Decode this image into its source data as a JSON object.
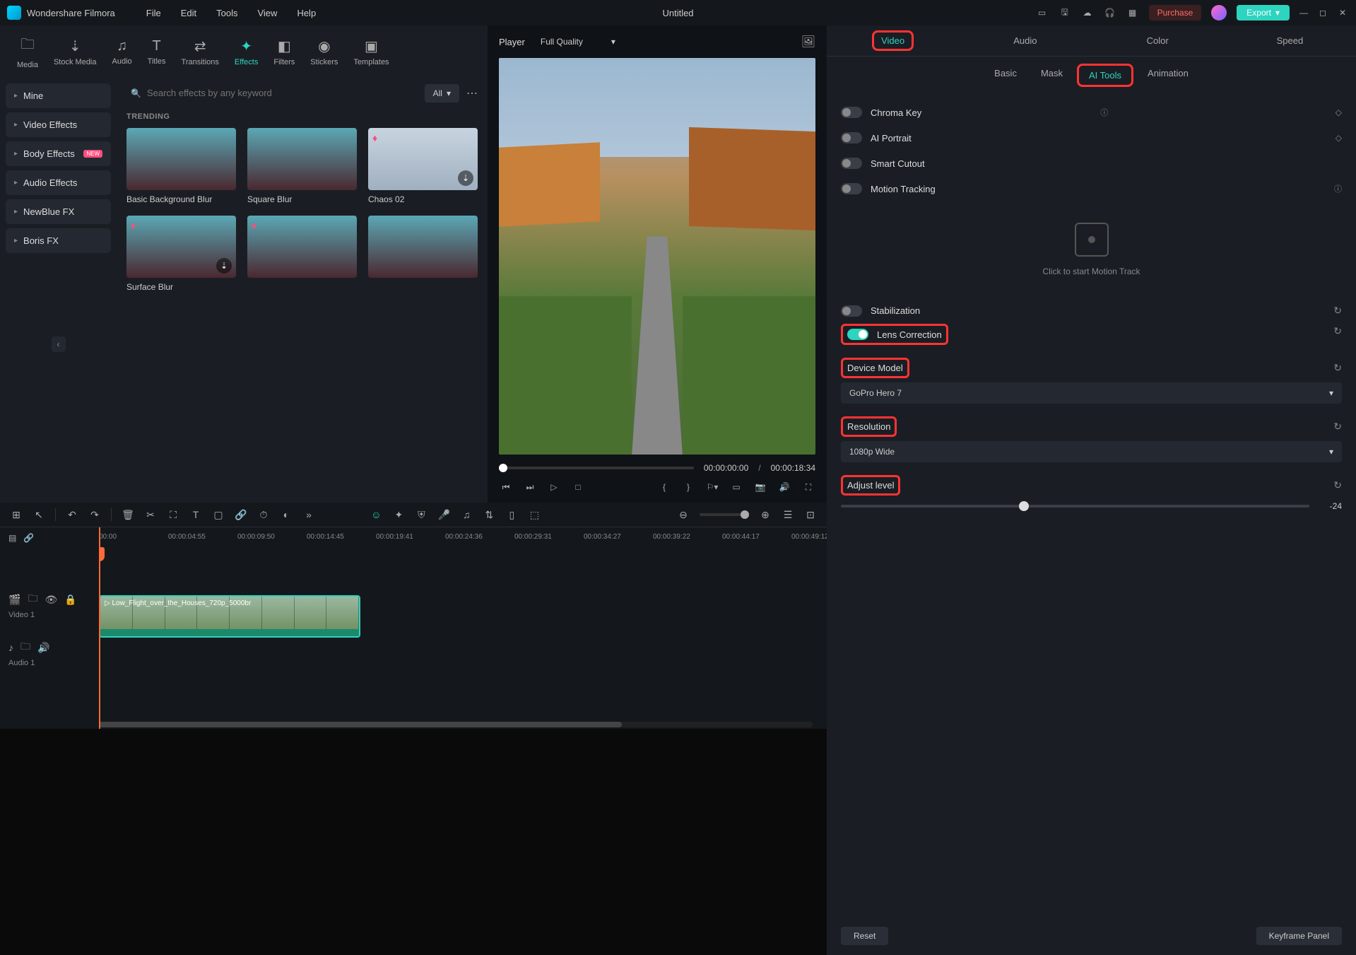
{
  "app": {
    "name": "Wondershare Filmora",
    "doc_title": "Untitled"
  },
  "menubar": [
    "File",
    "Edit",
    "Tools",
    "View",
    "Help"
  ],
  "titlebar_buttons": {
    "purchase": "Purchase",
    "export": "Export"
  },
  "media_tabs": [
    {
      "label": "Media"
    },
    {
      "label": "Stock Media"
    },
    {
      "label": "Audio"
    },
    {
      "label": "Titles"
    },
    {
      "label": "Transitions"
    },
    {
      "label": "Effects"
    },
    {
      "label": "Filters"
    },
    {
      "label": "Stickers"
    },
    {
      "label": "Templates"
    }
  ],
  "sidebar": {
    "items": [
      {
        "label": "Mine"
      },
      {
        "label": "Video Effects"
      },
      {
        "label": "Body Effects",
        "badge": "NEW"
      },
      {
        "label": "Audio Effects"
      },
      {
        "label": "NewBlue FX"
      },
      {
        "label": "Boris FX"
      }
    ]
  },
  "search": {
    "placeholder": "Search effects by any keyword",
    "filter": "All"
  },
  "effects": {
    "section": "TRENDING",
    "items": [
      {
        "label": "Basic Background Blur"
      },
      {
        "label": "Square Blur"
      },
      {
        "label": "Chaos 02"
      },
      {
        "label": "Surface Blur"
      }
    ]
  },
  "player": {
    "label": "Player",
    "quality": "Full Quality",
    "current_time": "00:00:00:00",
    "duration": "00:00:18:34"
  },
  "props": {
    "tabs": [
      "Video",
      "Audio",
      "Color",
      "Speed"
    ],
    "subtabs": [
      "Basic",
      "Mask",
      "AI Tools",
      "Animation"
    ],
    "chroma_key": "Chroma Key",
    "ai_portrait": "AI Portrait",
    "smart_cutout": "Smart Cutout",
    "motion_tracking": "Motion Tracking",
    "motion_track_hint": "Click to start Motion Track",
    "stabilization": "Stabilization",
    "lens_correction": "Lens Correction",
    "device_model": {
      "label": "Device Model",
      "value": "GoPro Hero 7"
    },
    "resolution": {
      "label": "Resolution",
      "value": "1080p Wide"
    },
    "adjust_level": {
      "label": "Adjust level",
      "value": "-24"
    },
    "footer": {
      "reset": "Reset",
      "keyframe": "Keyframe Panel"
    }
  },
  "timeline": {
    "ruler": [
      "00:00",
      "00:00:04:55",
      "00:00:09:50",
      "00:00:14:45",
      "00:00:19:41",
      "00:00:24:36",
      "00:00:29:31",
      "00:00:34:27",
      "00:00:39:22",
      "00:00:44:17",
      "00:00:49:12"
    ],
    "video_track": "Video 1",
    "audio_track": "Audio 1",
    "clip_name": "Low_Flight_over_the_Houses_720p_5000br"
  }
}
